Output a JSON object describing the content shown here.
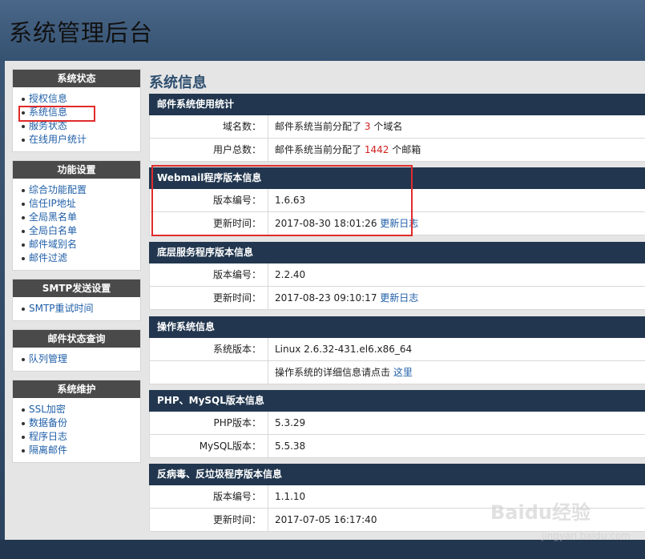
{
  "header": {
    "title": "系统管理后台"
  },
  "sidebar": {
    "groups": [
      {
        "title": "系统状态",
        "items": [
          "授权信息",
          "系统信息",
          "服务状态",
          "在线用户统计"
        ]
      },
      {
        "title": "功能设置",
        "items": [
          "综合功能配置",
          "信任IP地址",
          "全局黑名单",
          "全局白名单",
          "邮件域别名",
          "邮件过滤"
        ]
      },
      {
        "title": "SMTP发送设置",
        "items": [
          "SMTP重试时间"
        ]
      },
      {
        "title": "邮件状态查询",
        "items": [
          "队列管理"
        ]
      },
      {
        "title": "系统维护",
        "items": [
          "SSL加密",
          "数据备份",
          "程序日志",
          "隔离邮件"
        ]
      }
    ]
  },
  "main": {
    "title": "系统信息",
    "mail_usage": {
      "title": "邮件系统使用统计",
      "domains_label": "域名数：",
      "domains_prefix": "邮件系统当前分配了",
      "domains_count": "3",
      "domains_suffix": "个域名",
      "users_label": "用户总数：",
      "users_prefix": "邮件系统当前分配了",
      "users_count": "1442",
      "users_suffix": "个邮箱"
    },
    "webmail": {
      "title": "Webmail程序版本信息",
      "version_label": "版本编号：",
      "version": "1.6.63",
      "updated_label": "更新时间：",
      "updated": "2017-08-30 18:01:26",
      "changelog": "更新日志"
    },
    "backend": {
      "title": "底层服务程序版本信息",
      "version_label": "版本编号：",
      "version": "2.2.40",
      "updated_label": "更新时间：",
      "updated": "2017-08-23 09:10:17",
      "changelog": "更新日志"
    },
    "os": {
      "title": "操作系统信息",
      "version_label": "系统版本：",
      "version": "Linux 2.6.32-431.el6.x86_64",
      "detail_prefix": "操作系统的详细信息请点击",
      "detail_link": "这里"
    },
    "php_mysql": {
      "title": "PHP、MySQL版本信息",
      "php_label": "PHP版本：",
      "php": "5.3.29",
      "mysql_label": "MySQL版本：",
      "mysql": "5.5.38"
    },
    "antivirus": {
      "title": "反病毒、反垃圾程序版本信息",
      "version_label": "版本编号：",
      "version": "1.1.10",
      "updated_label": "更新时间：",
      "updated": "2017-07-05 16:17:40"
    }
  },
  "watermark": {
    "text": "Baidu经验",
    "sub": "jingyan.baidu.com"
  },
  "colors": {
    "highlight": "#e02b2b",
    "header_dark": "#22374f",
    "link": "#1f5fa8",
    "number_red": "#d01d1d"
  }
}
